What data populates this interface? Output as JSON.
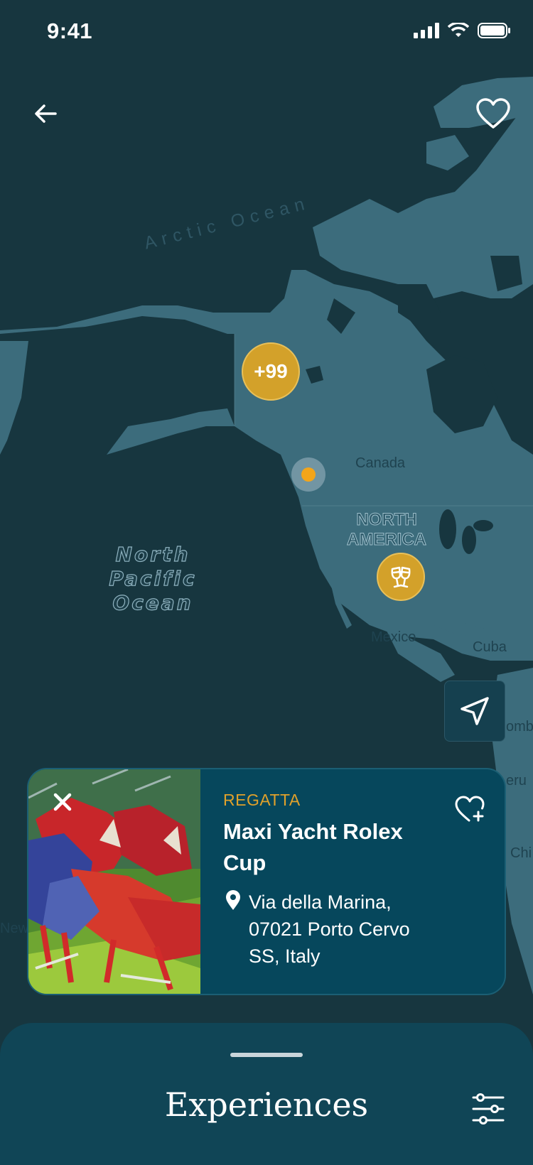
{
  "status_bar": {
    "time": "9:41"
  },
  "map": {
    "ocean_arctic": "Arctic Ocean",
    "ocean_pacific": "North\nPacific\nOcean",
    "continent": "NORTH\nAMERICA",
    "countries": {
      "canada": "Canada",
      "mexico": "Mexico",
      "cuba": "Cuba",
      "colombia": "omb",
      "peru": "eru",
      "chile": "Chi",
      "new": "New"
    },
    "cluster_count": "+99"
  },
  "event_card": {
    "category": "REGATTA",
    "title": "Maxi Yacht Rolex Cup",
    "address": "Via della Marina,\n07021 Porto Cervo\nSS, Italy"
  },
  "bottom_sheet": {
    "title": "Experiences"
  },
  "colors": {
    "accent_gold": "#d3a12a",
    "map_water": "#17363f",
    "map_land": "#3c6c7c",
    "card_bg": "#06475c"
  },
  "icons": [
    "back-arrow-icon",
    "heart-icon",
    "champagne-glasses-icon",
    "navigation-arrow-icon",
    "close-icon",
    "heart-plus-icon",
    "location-pin-icon",
    "filter-sliders-icon"
  ]
}
